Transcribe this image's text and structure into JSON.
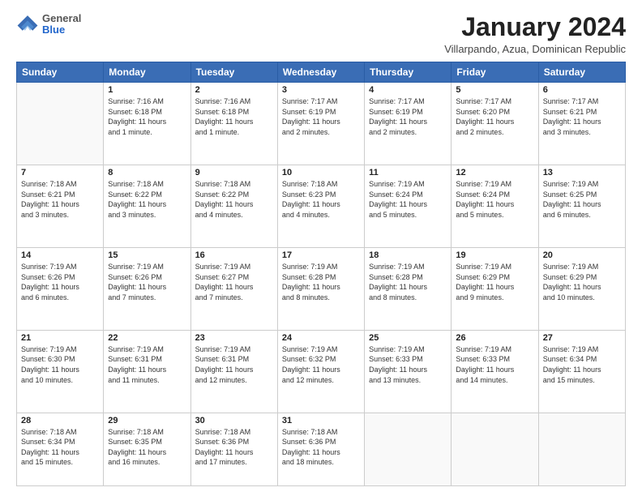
{
  "header": {
    "logo": {
      "general": "General",
      "blue": "Blue"
    },
    "title": "January 2024",
    "subtitle": "Villarpando, Azua, Dominican Republic"
  },
  "calendar": {
    "days_of_week": [
      "Sunday",
      "Monday",
      "Tuesday",
      "Wednesday",
      "Thursday",
      "Friday",
      "Saturday"
    ],
    "weeks": [
      [
        {
          "day": "",
          "info": ""
        },
        {
          "day": "1",
          "info": "Sunrise: 7:16 AM\nSunset: 6:18 PM\nDaylight: 11 hours\nand 1 minute."
        },
        {
          "day": "2",
          "info": "Sunrise: 7:16 AM\nSunset: 6:18 PM\nDaylight: 11 hours\nand 1 minute."
        },
        {
          "day": "3",
          "info": "Sunrise: 7:17 AM\nSunset: 6:19 PM\nDaylight: 11 hours\nand 2 minutes."
        },
        {
          "day": "4",
          "info": "Sunrise: 7:17 AM\nSunset: 6:19 PM\nDaylight: 11 hours\nand 2 minutes."
        },
        {
          "day": "5",
          "info": "Sunrise: 7:17 AM\nSunset: 6:20 PM\nDaylight: 11 hours\nand 2 minutes."
        },
        {
          "day": "6",
          "info": "Sunrise: 7:17 AM\nSunset: 6:21 PM\nDaylight: 11 hours\nand 3 minutes."
        }
      ],
      [
        {
          "day": "7",
          "info": "Sunrise: 7:18 AM\nSunset: 6:21 PM\nDaylight: 11 hours\nand 3 minutes."
        },
        {
          "day": "8",
          "info": "Sunrise: 7:18 AM\nSunset: 6:22 PM\nDaylight: 11 hours\nand 3 minutes."
        },
        {
          "day": "9",
          "info": "Sunrise: 7:18 AM\nSunset: 6:22 PM\nDaylight: 11 hours\nand 4 minutes."
        },
        {
          "day": "10",
          "info": "Sunrise: 7:18 AM\nSunset: 6:23 PM\nDaylight: 11 hours\nand 4 minutes."
        },
        {
          "day": "11",
          "info": "Sunrise: 7:19 AM\nSunset: 6:24 PM\nDaylight: 11 hours\nand 5 minutes."
        },
        {
          "day": "12",
          "info": "Sunrise: 7:19 AM\nSunset: 6:24 PM\nDaylight: 11 hours\nand 5 minutes."
        },
        {
          "day": "13",
          "info": "Sunrise: 7:19 AM\nSunset: 6:25 PM\nDaylight: 11 hours\nand 6 minutes."
        }
      ],
      [
        {
          "day": "14",
          "info": "Sunrise: 7:19 AM\nSunset: 6:26 PM\nDaylight: 11 hours\nand 6 minutes."
        },
        {
          "day": "15",
          "info": "Sunrise: 7:19 AM\nSunset: 6:26 PM\nDaylight: 11 hours\nand 7 minutes."
        },
        {
          "day": "16",
          "info": "Sunrise: 7:19 AM\nSunset: 6:27 PM\nDaylight: 11 hours\nand 7 minutes."
        },
        {
          "day": "17",
          "info": "Sunrise: 7:19 AM\nSunset: 6:28 PM\nDaylight: 11 hours\nand 8 minutes."
        },
        {
          "day": "18",
          "info": "Sunrise: 7:19 AM\nSunset: 6:28 PM\nDaylight: 11 hours\nand 8 minutes."
        },
        {
          "day": "19",
          "info": "Sunrise: 7:19 AM\nSunset: 6:29 PM\nDaylight: 11 hours\nand 9 minutes."
        },
        {
          "day": "20",
          "info": "Sunrise: 7:19 AM\nSunset: 6:29 PM\nDaylight: 11 hours\nand 10 minutes."
        }
      ],
      [
        {
          "day": "21",
          "info": "Sunrise: 7:19 AM\nSunset: 6:30 PM\nDaylight: 11 hours\nand 10 minutes."
        },
        {
          "day": "22",
          "info": "Sunrise: 7:19 AM\nSunset: 6:31 PM\nDaylight: 11 hours\nand 11 minutes."
        },
        {
          "day": "23",
          "info": "Sunrise: 7:19 AM\nSunset: 6:31 PM\nDaylight: 11 hours\nand 12 minutes."
        },
        {
          "day": "24",
          "info": "Sunrise: 7:19 AM\nSunset: 6:32 PM\nDaylight: 11 hours\nand 12 minutes."
        },
        {
          "day": "25",
          "info": "Sunrise: 7:19 AM\nSunset: 6:33 PM\nDaylight: 11 hours\nand 13 minutes."
        },
        {
          "day": "26",
          "info": "Sunrise: 7:19 AM\nSunset: 6:33 PM\nDaylight: 11 hours\nand 14 minutes."
        },
        {
          "day": "27",
          "info": "Sunrise: 7:19 AM\nSunset: 6:34 PM\nDaylight: 11 hours\nand 15 minutes."
        }
      ],
      [
        {
          "day": "28",
          "info": "Sunrise: 7:18 AM\nSunset: 6:34 PM\nDaylight: 11 hours\nand 15 minutes."
        },
        {
          "day": "29",
          "info": "Sunrise: 7:18 AM\nSunset: 6:35 PM\nDaylight: 11 hours\nand 16 minutes."
        },
        {
          "day": "30",
          "info": "Sunrise: 7:18 AM\nSunset: 6:36 PM\nDaylight: 11 hours\nand 17 minutes."
        },
        {
          "day": "31",
          "info": "Sunrise: 7:18 AM\nSunset: 6:36 PM\nDaylight: 11 hours\nand 18 minutes."
        },
        {
          "day": "",
          "info": ""
        },
        {
          "day": "",
          "info": ""
        },
        {
          "day": "",
          "info": ""
        }
      ]
    ]
  }
}
